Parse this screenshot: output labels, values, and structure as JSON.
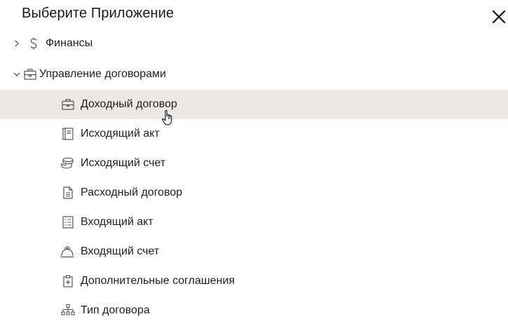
{
  "dialog": {
    "title": "Выберите Приложение"
  },
  "tree": {
    "groups": [
      {
        "label": "Финансы",
        "expanded": false,
        "icon": "dollar-icon"
      },
      {
        "label": "Управление договорами",
        "expanded": true,
        "icon": "briefcase-icon"
      }
    ],
    "items": [
      {
        "label": "Доходный договор",
        "icon": "briefcase-icon",
        "selected": true
      },
      {
        "label": "Исходящий акт",
        "icon": "ledger-book-icon"
      },
      {
        "label": "Исходящий счет",
        "icon": "coin-stack-icon"
      },
      {
        "label": "Расходный договор",
        "icon": "document-icon"
      },
      {
        "label": "Входящий акт",
        "icon": "checklist-icon"
      },
      {
        "label": "Входящий счет",
        "icon": "service-bell-icon"
      },
      {
        "label": "Дополнительные соглашения",
        "icon": "clipboard-plus-icon"
      },
      {
        "label": "Тип договора",
        "icon": "hierarchy-icon"
      }
    ]
  },
  "colors": {
    "selected_row": "#ebe8e6",
    "text": "#1f1f1f",
    "icon": "#555555"
  }
}
